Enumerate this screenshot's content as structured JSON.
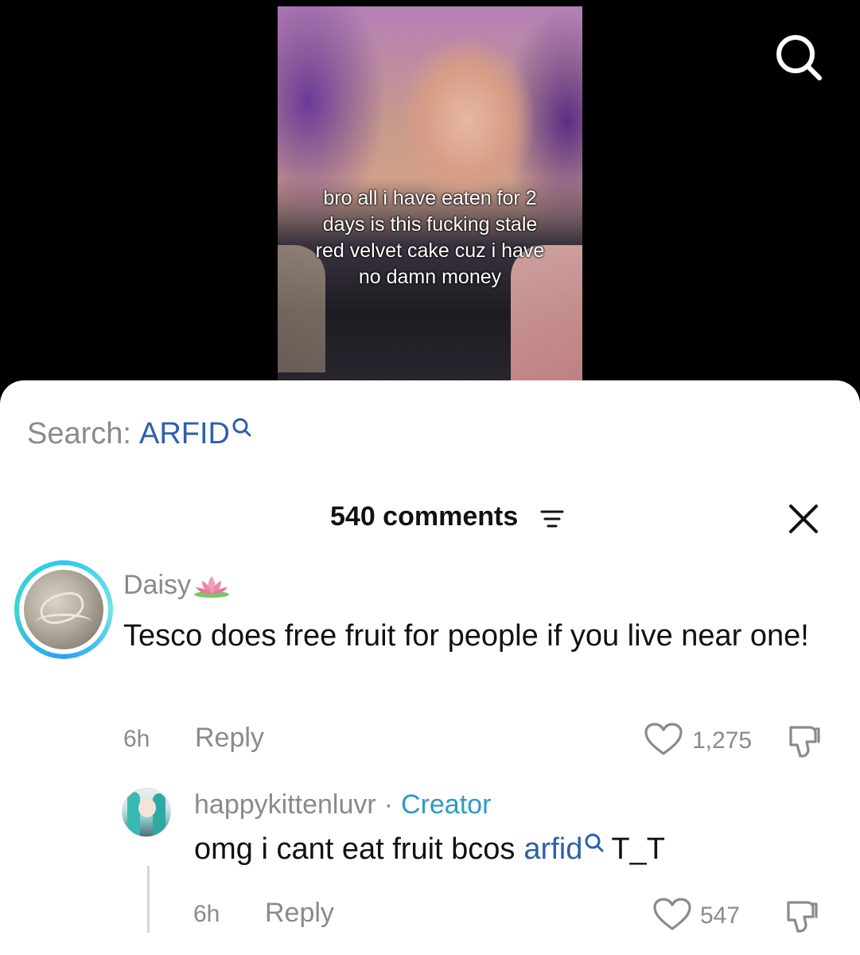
{
  "video": {
    "caption": "bro all i have eaten for 2\ndays is this fucking stale\nred velvet cake cuz i have\nno damn money",
    "search_icon": "search-icon"
  },
  "sheet": {
    "search_label": "Search:",
    "search_term": "ARFID",
    "comments_count": "540 comments",
    "sort_icon": "sort-lines-icon",
    "close_icon": "close-icon"
  },
  "comments": [
    {
      "username": "Daisy",
      "emoji_icon": "lotus-icon",
      "text": "Tesco does free fruit for people if you live near one!",
      "time": "6h",
      "reply_label": "Reply",
      "likes": "1,275"
    },
    {
      "username": "happykittenluvr",
      "separator": "·",
      "badge": "Creator",
      "text_before": "omg i cant eat fruit bcos",
      "link_term": "arfid",
      "text_after": "T_T",
      "time": "6h",
      "reply_label": "Reply",
      "likes": "547"
    }
  ],
  "colors": {
    "link_blue": "#2d5fad",
    "creator_blue": "#2e9ac8",
    "muted_gray": "#8a8a8a",
    "avatar_ring": "#2fc8f2"
  }
}
